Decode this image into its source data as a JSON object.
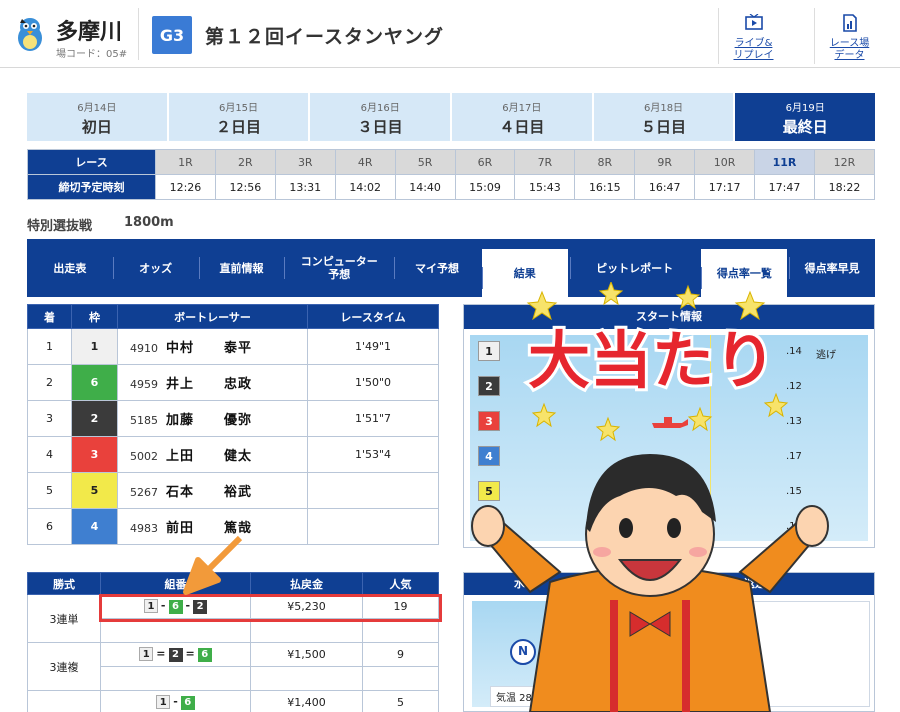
{
  "header": {
    "venue": "多摩川",
    "venue_code": "場コード：05#",
    "grade": "G3",
    "title": "第１２回イースタンヤング",
    "links": [
      {
        "label_line1": "ライブ&",
        "label_line2": "リプレイ",
        "icon": "play-tv-icon"
      },
      {
        "label_line1": "レース場",
        "label_line2": "データ",
        "icon": "chart-document-icon"
      }
    ]
  },
  "days": [
    {
      "date": "6月14日",
      "label": "初日"
    },
    {
      "date": "6月15日",
      "label": "２日目"
    },
    {
      "date": "6月16日",
      "label": "３日目"
    },
    {
      "date": "6月17日",
      "label": "４日目"
    },
    {
      "date": "6月18日",
      "label": "５日目"
    },
    {
      "date": "6月19日",
      "label": "最終日"
    }
  ],
  "race_table": {
    "race_label": "レース",
    "time_label": "締切予定時刻",
    "races": [
      "1R",
      "2R",
      "3R",
      "4R",
      "5R",
      "6R",
      "7R",
      "8R",
      "9R",
      "10R",
      "11R",
      "12R"
    ],
    "times": [
      "12:26",
      "12:56",
      "13:31",
      "14:02",
      "14:40",
      "15:09",
      "15:43",
      "16:15",
      "16:47",
      "17:17",
      "17:47",
      "18:22"
    ],
    "active_index": 10
  },
  "race_info": {
    "kind": "特別選抜戦",
    "distance": "1800m"
  },
  "nav": [
    {
      "label": "出走表"
    },
    {
      "label": "オッズ"
    },
    {
      "label": "直前情報"
    },
    {
      "label": "コンピューター予想"
    },
    {
      "label": "マイ予想"
    },
    {
      "label": "結果"
    },
    {
      "label": "ピットレポート"
    },
    {
      "label": "得点率一覧"
    },
    {
      "label": "得点率早見"
    }
  ],
  "results": {
    "headers": [
      "着",
      "枠",
      "ボートレーサー",
      "レースタイム"
    ],
    "rows": [
      {
        "place": "1",
        "frame": "1",
        "reg": "4910",
        "family": "中村",
        "given": "泰平",
        "time": "1'49\"1",
        "color": "w"
      },
      {
        "place": "2",
        "frame": "6",
        "reg": "4959",
        "family": "井上",
        "given": "忠政",
        "time": "1'50\"0",
        "color": "g"
      },
      {
        "place": "3",
        "frame": "2",
        "reg": "5185",
        "family": "加藤",
        "given": "優弥",
        "time": "1'51\"7",
        "color": "k"
      },
      {
        "place": "4",
        "frame": "3",
        "reg": "5002",
        "family": "上田",
        "given": "健太",
        "time": "1'53\"4",
        "color": "r"
      },
      {
        "place": "5",
        "frame": "5",
        "reg": "5267",
        "family": "石本",
        "given": "裕武",
        "time": "",
        "color": "y"
      },
      {
        "place": "6",
        "frame": "4",
        "reg": "4983",
        "family": "前田",
        "given": "篤哉",
        "time": "",
        "color": "b"
      }
    ]
  },
  "start_info": {
    "title": "スタート情報",
    "lanes": [
      {
        "n": "1",
        "st": ".14",
        "note": "逃げ",
        "color": "w"
      },
      {
        "n": "2",
        "st": ".12",
        "note": "",
        "color": "k"
      },
      {
        "n": "3",
        "st": ".13",
        "note": "",
        "color": "r"
      },
      {
        "n": "4",
        "st": ".17",
        "note": "",
        "color": "b"
      },
      {
        "n": "5",
        "st": ".15",
        "note": "",
        "color": "y"
      },
      {
        "n": "6",
        "st": ".15",
        "note": "",
        "color": "g"
      }
    ]
  },
  "payout": {
    "headers": [
      "勝式",
      "組番",
      "払戻金",
      "人気"
    ],
    "rows": [
      {
        "type": "3連単",
        "combo": [
          {
            "n": "1",
            "c": "w"
          },
          {
            "s": "-"
          },
          {
            "n": "6",
            "c": "g"
          },
          {
            "s": "-"
          },
          {
            "n": "2",
            "c": "k"
          }
        ],
        "amount": "¥5,230",
        "pop": "19"
      },
      {
        "type": "3連複",
        "combo": [
          {
            "n": "1",
            "c": "w"
          },
          {
            "s": "="
          },
          {
            "n": "2",
            "c": "k"
          },
          {
            "s": "="
          },
          {
            "n": "6",
            "c": "g"
          }
        ],
        "amount": "¥1,500",
        "pop": "9"
      },
      {
        "type": "",
        "combo": [
          {
            "n": "1",
            "c": "w"
          },
          {
            "s": "-"
          },
          {
            "n": "6",
            "c": "g"
          }
        ],
        "amount": "¥1,400",
        "pop": "5"
      }
    ]
  },
  "weather": {
    "title_left": "水面",
    "title_right": "返還",
    "temp": "気温 28.0℃",
    "compass_letter": "N"
  },
  "overlay": {
    "banner": "大当たり"
  },
  "colors": {
    "navy": "#0f3f93",
    "light_blue": "#d6e8f7",
    "highlight": "#e53b3b"
  }
}
